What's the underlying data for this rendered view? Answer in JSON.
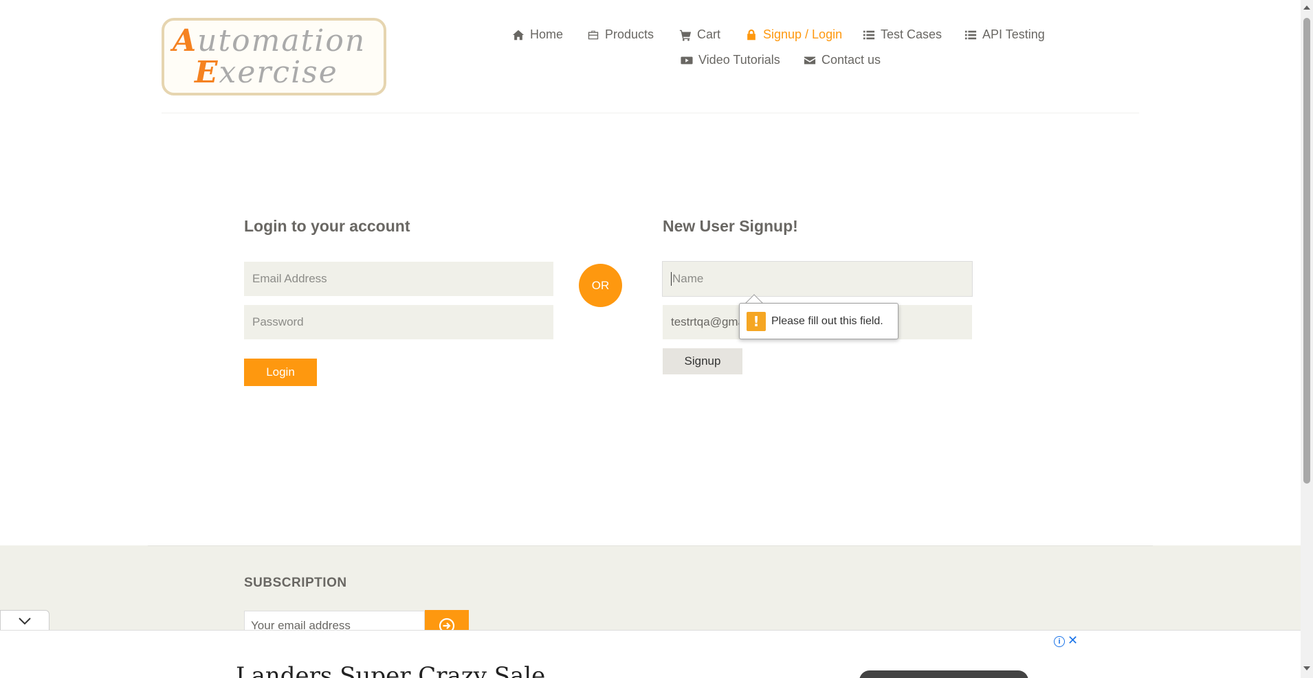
{
  "logo": {
    "line1_cap": "A",
    "line1_rest": "utomation",
    "line2_cap": "E",
    "line2_rest": "xercise"
  },
  "nav": {
    "items": [
      {
        "label": "Home",
        "icon": "home-icon"
      },
      {
        "label": "Products",
        "icon": "briefcase-icon"
      },
      {
        "label": "Cart",
        "icon": "cart-icon"
      },
      {
        "label": "Signup / Login",
        "icon": "lock-icon",
        "active": true
      },
      {
        "label": "Test Cases",
        "icon": "list-icon"
      },
      {
        "label": "API Testing",
        "icon": "list-icon"
      },
      {
        "label": "Video Tutorials",
        "icon": "youtube-icon"
      },
      {
        "label": "Contact us",
        "icon": "envelope-icon"
      }
    ]
  },
  "login": {
    "title": "Login to your account",
    "email_placeholder": "Email Address",
    "password_placeholder": "Password",
    "button": "Login"
  },
  "or_label": "OR",
  "signup": {
    "title": "New User Signup!",
    "name_placeholder": "Name",
    "email_value": "testrtqa@gmail.com",
    "button": "Signup"
  },
  "validation": {
    "message": "Please fill out this field."
  },
  "footer": {
    "subscription_title": "SUBSCRIPTION",
    "email_placeholder": "Your email address"
  },
  "ad": {
    "headline": "Landers Super Crazy Sale"
  },
  "colors": {
    "accent": "#fe980f",
    "field_bg": "#f0f0e9",
    "text": "#696763"
  }
}
